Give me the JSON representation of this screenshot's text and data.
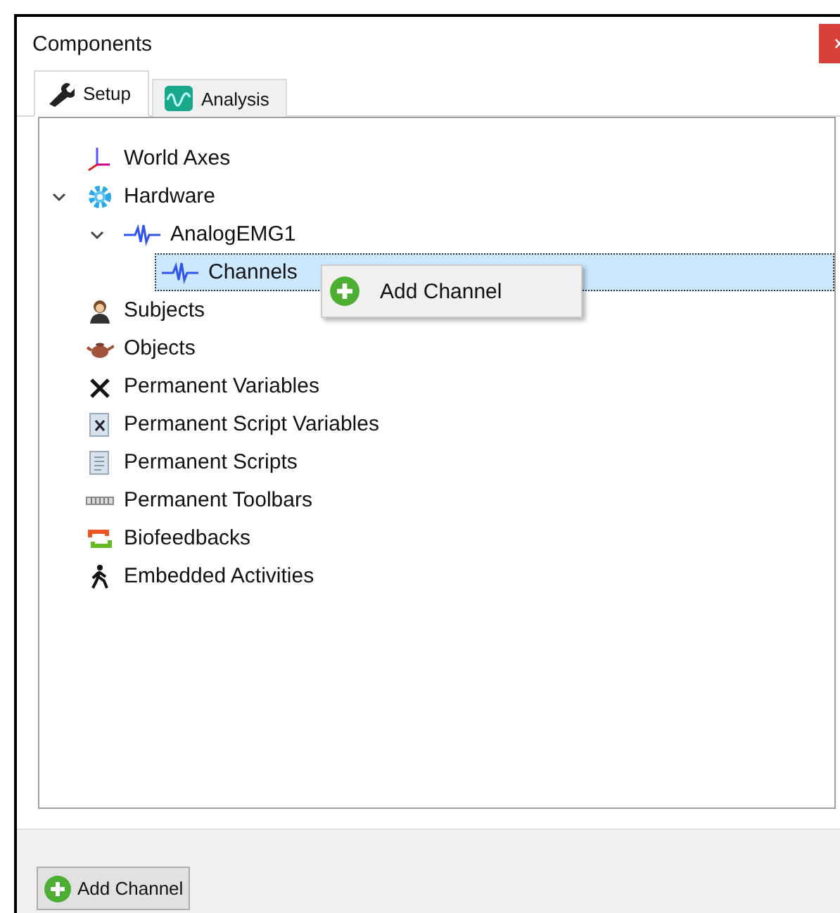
{
  "window": {
    "title": "Components"
  },
  "tabs": [
    {
      "label": "Setup",
      "kind": "wrench",
      "selected": true
    },
    {
      "label": "Analysis",
      "kind": "wave",
      "selected": false
    }
  ],
  "tree": [
    {
      "label": "World Axes",
      "kind": "axes",
      "selected": false
    },
    {
      "label": "Hardware",
      "kind": "gear",
      "selected": false,
      "expanded": true,
      "children": [
        {
          "label": "AnalogEMG1",
          "kind": "signal",
          "selected": false,
          "expanded": true,
          "children": [
            {
              "label": "Channels",
              "kind": "signal",
              "selected": true
            }
          ]
        }
      ]
    },
    {
      "label": "Subjects",
      "kind": "person",
      "selected": false
    },
    {
      "label": "Objects",
      "kind": "teapot",
      "selected": false
    },
    {
      "label": "Permanent Variables",
      "kind": "variable",
      "selected": false
    },
    {
      "label": "Permanent Script Variables",
      "kind": "scriptvar",
      "selected": false
    },
    {
      "label": "Permanent Scripts",
      "kind": "script",
      "selected": false
    },
    {
      "label": "Permanent Toolbars",
      "kind": "toolbar",
      "selected": false
    },
    {
      "label": "Biofeedbacks",
      "kind": "loop",
      "selected": false
    },
    {
      "label": "Embedded Activities",
      "kind": "walker",
      "selected": false
    }
  ],
  "context_menu": {
    "items": [
      {
        "label": "Add Channel"
      }
    ]
  },
  "footer_button": "Add Channel"
}
